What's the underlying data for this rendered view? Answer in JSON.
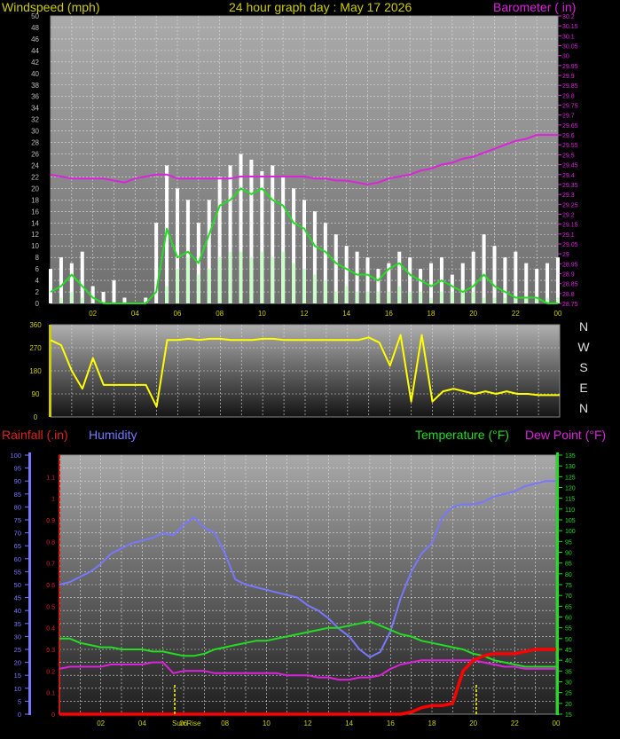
{
  "header": {
    "left_label": "Windspeed (mph)",
    "title": "24 hour graph day : May 17 2026",
    "right_label": "Barometer ( in)"
  },
  "compass": [
    "N",
    "W",
    "S",
    "E",
    "N"
  ],
  "lower_header": {
    "rain_label": "Rainfall (.in)",
    "humidity_label": "Humidity",
    "temp_label": "Temperature (°F)",
    "dew_label": "Dew Point (°F)"
  },
  "sunrise_label": "Sun Rise",
  "colors": {
    "wind": "#ffffff",
    "gust_avg": "#22dd22",
    "wind_light": "#ccffcc",
    "barometer": "#dd22dd",
    "direction": "#ffff00",
    "rain": "#ff0000",
    "humidity": "#7777ff",
    "temperature": "#22dd22",
    "dewpoint": "#dd22dd",
    "label_yellow": "#cccc00",
    "label_red": "#dd2222",
    "label_blue": "#7777ff",
    "label_green": "#22dd22",
    "label_magenta": "#dd22dd"
  },
  "chart_data": [
    {
      "type": "line",
      "id": "wind",
      "x_ticks": [
        "02",
        "04",
        "06",
        "08",
        "10",
        "12",
        "14",
        "16",
        "18",
        "20",
        "22",
        "00"
      ],
      "y_left_ticks": [
        "0",
        "2",
        "4",
        "6",
        "8",
        "10",
        "12",
        "14",
        "16",
        "18",
        "20",
        "22",
        "24",
        "26",
        "28",
        "30",
        "32",
        "34",
        "36",
        "38",
        "40",
        "42",
        "44",
        "46",
        "48",
        "50"
      ],
      "y_left_lim": [
        0,
        50
      ],
      "y_right_ticks": [
        "28.75",
        "28.8",
        "28.85",
        "28.9",
        "28.95",
        "29",
        "29.05",
        "29.1",
        "29.15",
        "29.2",
        "29.25",
        "29.3",
        "29.35",
        "29.4",
        "29.45",
        "29.5",
        "29.55",
        "29.6",
        "29.65",
        "29.7",
        "29.75",
        "29.8",
        "29.85",
        "29.9",
        "29.95",
        "30",
        "30.05",
        "30.1",
        "30.15",
        "30.2"
      ],
      "y_right_lim": [
        28.75,
        30.2
      ],
      "x_hours": [
        0,
        0.5,
        1,
        1.5,
        2,
        2.5,
        3,
        3.5,
        4,
        4.5,
        5,
        5.5,
        6,
        6.5,
        7,
        7.5,
        8,
        8.5,
        9,
        9.5,
        10,
        10.5,
        11,
        11.5,
        12,
        12.5,
        13,
        13.5,
        14,
        14.5,
        15,
        15.5,
        16,
        16.5,
        17,
        17.5,
        18,
        18.5,
        19,
        19.5,
        20,
        20.5,
        21,
        21.5,
        22,
        22.5,
        23,
        23.5,
        24
      ],
      "series": [
        {
          "id": "wind_peak",
          "values": [
            6,
            8,
            7,
            9,
            3,
            2,
            4,
            1,
            0,
            1,
            14,
            24,
            20,
            18,
            14,
            18,
            22,
            24,
            26,
            25,
            23,
            24,
            22,
            20,
            18,
            16,
            14,
            12,
            10,
            9,
            8,
            6,
            7,
            9,
            8,
            6,
            7,
            8,
            5,
            7,
            9,
            12,
            10,
            8,
            9,
            7,
            6,
            7,
            8
          ]
        },
        {
          "id": "wind_avg",
          "values": [
            2,
            3,
            5,
            3,
            1,
            0,
            0,
            0,
            0,
            0,
            2,
            13,
            8,
            9,
            7,
            12,
            17,
            18,
            20,
            19,
            20,
            18,
            17,
            14,
            13,
            10,
            9,
            7,
            6,
            5,
            5,
            4,
            6,
            7,
            5,
            4,
            3,
            4,
            3,
            2,
            3,
            5,
            3,
            2,
            1,
            1,
            1,
            0,
            0
          ]
        },
        {
          "id": "wind_low",
          "values": [
            0,
            1,
            2,
            1,
            0,
            0,
            0,
            0,
            0,
            0,
            0,
            3,
            6,
            8,
            5,
            6,
            8,
            9,
            9,
            8,
            9,
            8,
            9,
            7,
            6,
            5,
            4,
            2,
            3,
            2,
            2,
            2,
            2,
            3,
            2,
            2,
            1,
            2,
            2,
            2,
            2,
            1,
            1,
            1,
            1,
            1,
            1,
            1,
            1
          ]
        },
        {
          "id": "barometer",
          "values": [
            29.4,
            29.39,
            29.38,
            29.38,
            29.38,
            29.38,
            29.37,
            29.36,
            29.38,
            29.39,
            29.4,
            29.4,
            29.38,
            29.38,
            29.38,
            29.38,
            29.38,
            29.38,
            29.39,
            29.39,
            29.39,
            29.39,
            29.39,
            29.39,
            29.39,
            29.38,
            29.38,
            29.37,
            29.37,
            29.36,
            29.35,
            29.36,
            29.38,
            29.39,
            29.4,
            29.42,
            29.43,
            29.45,
            29.46,
            29.48,
            29.49,
            29.51,
            29.53,
            29.55,
            29.57,
            29.58,
            29.6,
            29.6,
            29.6
          ]
        }
      ]
    },
    {
      "type": "line",
      "id": "direction",
      "y_ticks": [
        "0",
        "90",
        "180",
        "270",
        "360"
      ],
      "y_lim": [
        0,
        360
      ],
      "x_hours": [
        0,
        0.5,
        1,
        1.5,
        2,
        2.5,
        3,
        3.5,
        4,
        4.5,
        5,
        5.5,
        6,
        6.5,
        7,
        7.5,
        8,
        8.5,
        9,
        9.5,
        10,
        10.5,
        11,
        11.5,
        12,
        12.5,
        13,
        13.5,
        14,
        14.5,
        15,
        15.5,
        16,
        16.5,
        17,
        17.5,
        18,
        18.5,
        19,
        19.5,
        20,
        20.5,
        21,
        21.5,
        22,
        22.5,
        23,
        23.5,
        24
      ],
      "series": [
        {
          "id": "wind_direction",
          "values": [
            300,
            280,
            180,
            110,
            230,
            125,
            125,
            125,
            125,
            125,
            40,
            300,
            300,
            305,
            300,
            305,
            305,
            300,
            300,
            300,
            305,
            305,
            300,
            300,
            300,
            300,
            300,
            300,
            300,
            300,
            310,
            290,
            200,
            320,
            60,
            320,
            60,
            100,
            110,
            100,
            90,
            100,
            90,
            100,
            90,
            90,
            85,
            85,
            85
          ]
        }
      ]
    },
    {
      "type": "line",
      "id": "temp_hum",
      "y_left_ticks": [
        "0",
        "5",
        "10",
        "15",
        "20",
        "25",
        "30",
        "35",
        "40",
        "45",
        "50",
        "55",
        "60",
        "65",
        "70",
        "75",
        "80",
        "85",
        "90",
        "95",
        "100"
      ],
      "y_left_lim": [
        0,
        100
      ],
      "y_rain_ticks": [
        "0",
        "0.1",
        "0.2",
        "0.3",
        "0.4",
        "0.5",
        "0.6",
        "0.7",
        "0.8",
        "0.9",
        "1",
        "1.1"
      ],
      "y_rain_lim": [
        0,
        1.2
      ],
      "y_right_ticks": [
        "15",
        "20",
        "25",
        "30",
        "35",
        "40",
        "45",
        "50",
        "55",
        "60",
        "65",
        "70",
        "75",
        "80",
        "85",
        "90",
        "95",
        "100",
        "105",
        "110",
        "115",
        "120",
        "125",
        "130",
        "135"
      ],
      "y_right_lim": [
        15,
        135
      ],
      "x_ticks": [
        "02",
        "04",
        "06",
        "08",
        "10",
        "12",
        "14",
        "16",
        "18",
        "20",
        "22",
        "00"
      ],
      "x_hours": [
        0,
        0.5,
        1,
        1.5,
        2,
        2.5,
        3,
        3.5,
        4,
        4.5,
        5,
        5.5,
        6,
        6.5,
        7,
        7.5,
        8,
        8.5,
        9,
        9.5,
        10,
        10.5,
        11,
        11.5,
        12,
        12.5,
        13,
        13.5,
        14,
        14.5,
        15,
        15.5,
        16,
        16.5,
        17,
        17.5,
        18,
        18.5,
        19,
        19.5,
        20,
        20.5,
        21,
        21.5,
        22,
        22.5,
        23,
        23.5,
        24
      ],
      "series": [
        {
          "id": "humidity",
          "values": [
            50,
            51,
            53,
            55,
            58,
            62,
            64,
            66,
            67,
            68,
            70,
            69,
            73,
            76,
            72,
            70,
            62,
            52,
            50,
            49,
            48,
            47,
            46,
            45,
            42,
            40,
            37,
            33,
            30,
            25,
            22,
            24,
            32,
            45,
            55,
            62,
            66,
            76,
            80,
            81,
            81,
            82,
            84,
            85,
            86,
            88,
            89,
            90,
            90
          ]
        },
        {
          "id": "temperature",
          "values": [
            50,
            50,
            48,
            47,
            46,
            46,
            45,
            45,
            45,
            44,
            44,
            43,
            42,
            42,
            43,
            45,
            46,
            47,
            48,
            49,
            49,
            50,
            51,
            52,
            53,
            54,
            55,
            55,
            56,
            57,
            58,
            56,
            54,
            52,
            51,
            49,
            48,
            47,
            46,
            45,
            43,
            42,
            40,
            39,
            38,
            37,
            37,
            37,
            37
          ]
        },
        {
          "id": "dewpoint",
          "values": [
            36,
            37,
            37,
            37,
            37,
            38,
            38,
            38,
            38,
            39,
            39,
            34,
            35,
            35,
            35,
            34,
            34,
            34,
            34,
            34,
            34,
            34,
            33,
            33,
            33,
            32,
            32,
            31,
            31,
            32,
            32,
            33,
            36,
            38,
            39,
            40,
            40,
            40,
            40,
            40,
            40,
            39,
            38,
            37,
            37,
            36,
            36,
            36,
            36
          ]
        },
        {
          "id": "rainfall",
          "values": [
            0,
            0,
            0,
            0,
            0,
            0,
            0,
            0,
            0,
            0,
            0,
            0,
            0,
            0,
            0,
            0,
            0,
            0,
            0,
            0,
            0,
            0,
            0,
            0,
            0,
            0,
            0,
            0,
            0,
            0,
            0,
            0,
            0,
            0,
            0.01,
            0.03,
            0.04,
            0.04,
            0.05,
            0.2,
            0.25,
            0.27,
            0.28,
            0.28,
            0.28,
            0.29,
            0.3,
            0.3,
            0.3
          ]
        }
      ]
    }
  ]
}
